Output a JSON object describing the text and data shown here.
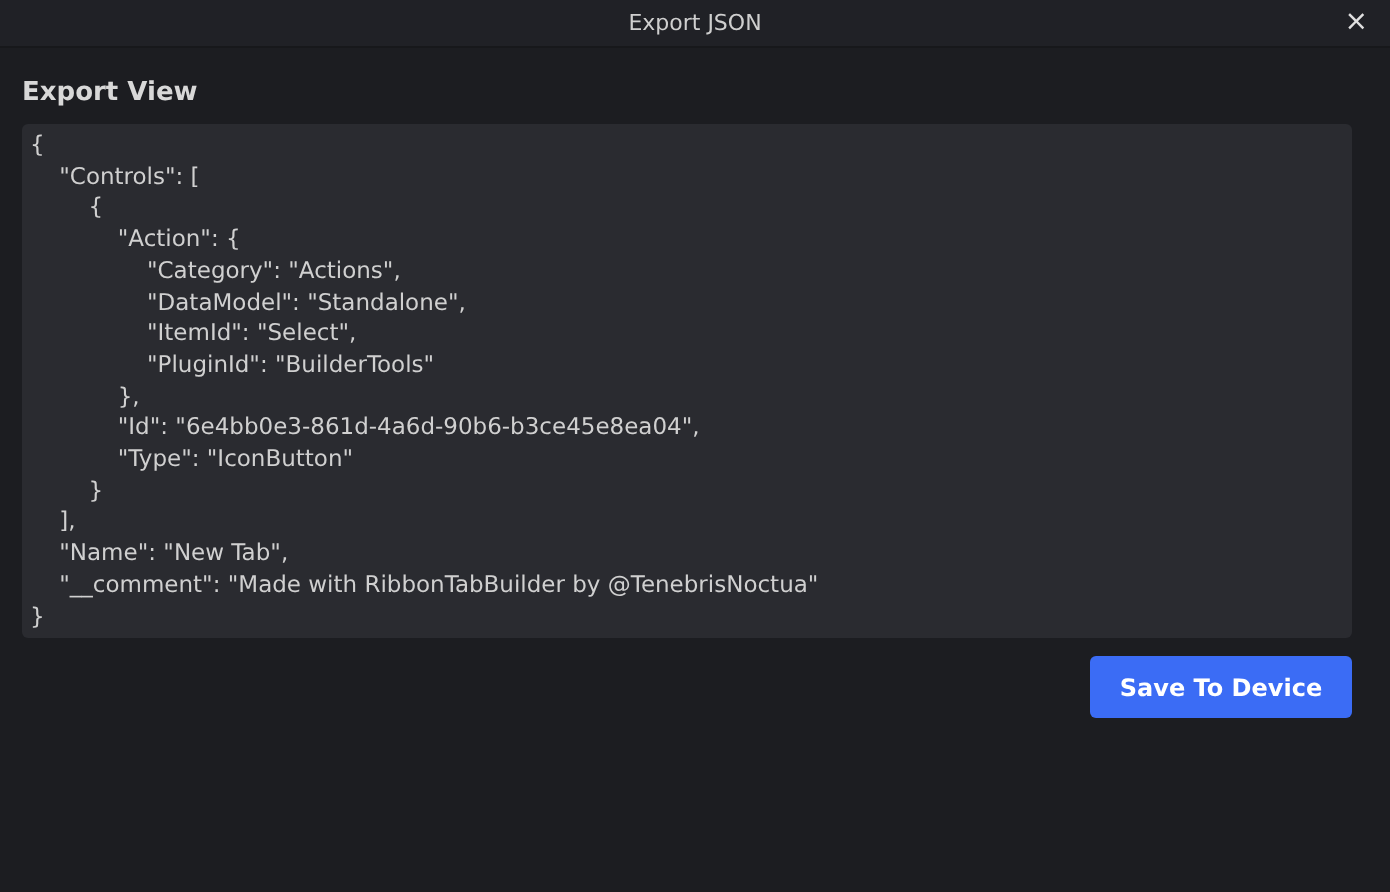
{
  "window": {
    "title": "Export JSON",
    "close": "×"
  },
  "heading": "Export View",
  "code_lines": [
    "{",
    "    \"Controls\": [",
    "        {",
    "            \"Action\": {",
    "                \"Category\": \"Actions\",",
    "                \"DataModel\": \"Standalone\",",
    "                \"ItemId\": \"Select\",",
    "                \"PluginId\": \"BuilderTools\"",
    "            },",
    "            \"Id\": \"6e4bb0e3-861d-4a6d-90b6-b3ce45e8ea04\",",
    "            \"Type\": \"IconButton\"",
    "        }",
    "    ],",
    "    \"Name\": \"New Tab\",",
    "    \"__comment\": \"Made with RibbonTabBuilder by @TenebrisNoctua\"",
    "}"
  ],
  "buttons": [
    "Save To Device"
  ]
}
